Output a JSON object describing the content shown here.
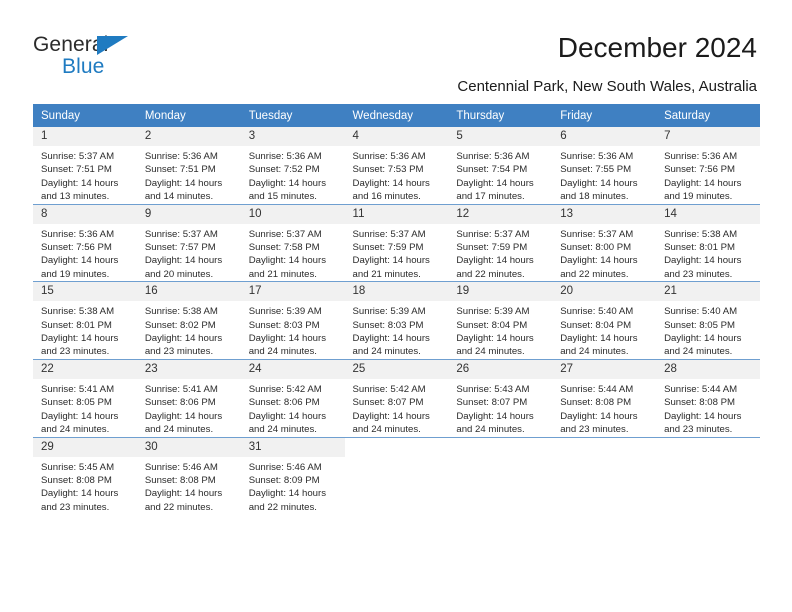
{
  "brand": {
    "name_part1": "General",
    "name_part2": "Blue",
    "accent_color": "#1f7bc1",
    "triangle_icon": "triangle-icon"
  },
  "header": {
    "title": "December 2024",
    "subtitle": "Centennial Park, New South Wales, Australia"
  },
  "calendar": {
    "header_bg": "#3f80c2",
    "daynum_bg": "#f1f1f1",
    "weekdays": [
      "Sunday",
      "Monday",
      "Tuesday",
      "Wednesday",
      "Thursday",
      "Friday",
      "Saturday"
    ],
    "labels": {
      "sunrise": "Sunrise:",
      "sunset": "Sunset:",
      "daylight": "Daylight:"
    },
    "weeks": [
      [
        {
          "day": "1",
          "sunrise": "Sunrise: 5:37 AM",
          "sunset": "Sunset: 7:51 PM",
          "daylight": "Daylight: 14 hours and 13 minutes."
        },
        {
          "day": "2",
          "sunrise": "Sunrise: 5:36 AM",
          "sunset": "Sunset: 7:51 PM",
          "daylight": "Daylight: 14 hours and 14 minutes."
        },
        {
          "day": "3",
          "sunrise": "Sunrise: 5:36 AM",
          "sunset": "Sunset: 7:52 PM",
          "daylight": "Daylight: 14 hours and 15 minutes."
        },
        {
          "day": "4",
          "sunrise": "Sunrise: 5:36 AM",
          "sunset": "Sunset: 7:53 PM",
          "daylight": "Daylight: 14 hours and 16 minutes."
        },
        {
          "day": "5",
          "sunrise": "Sunrise: 5:36 AM",
          "sunset": "Sunset: 7:54 PM",
          "daylight": "Daylight: 14 hours and 17 minutes."
        },
        {
          "day": "6",
          "sunrise": "Sunrise: 5:36 AM",
          "sunset": "Sunset: 7:55 PM",
          "daylight": "Daylight: 14 hours and 18 minutes."
        },
        {
          "day": "7",
          "sunrise": "Sunrise: 5:36 AM",
          "sunset": "Sunset: 7:56 PM",
          "daylight": "Daylight: 14 hours and 19 minutes."
        }
      ],
      [
        {
          "day": "8",
          "sunrise": "Sunrise: 5:36 AM",
          "sunset": "Sunset: 7:56 PM",
          "daylight": "Daylight: 14 hours and 19 minutes."
        },
        {
          "day": "9",
          "sunrise": "Sunrise: 5:37 AM",
          "sunset": "Sunset: 7:57 PM",
          "daylight": "Daylight: 14 hours and 20 minutes."
        },
        {
          "day": "10",
          "sunrise": "Sunrise: 5:37 AM",
          "sunset": "Sunset: 7:58 PM",
          "daylight": "Daylight: 14 hours and 21 minutes."
        },
        {
          "day": "11",
          "sunrise": "Sunrise: 5:37 AM",
          "sunset": "Sunset: 7:59 PM",
          "daylight": "Daylight: 14 hours and 21 minutes."
        },
        {
          "day": "12",
          "sunrise": "Sunrise: 5:37 AM",
          "sunset": "Sunset: 7:59 PM",
          "daylight": "Daylight: 14 hours and 22 minutes."
        },
        {
          "day": "13",
          "sunrise": "Sunrise: 5:37 AM",
          "sunset": "Sunset: 8:00 PM",
          "daylight": "Daylight: 14 hours and 22 minutes."
        },
        {
          "day": "14",
          "sunrise": "Sunrise: 5:38 AM",
          "sunset": "Sunset: 8:01 PM",
          "daylight": "Daylight: 14 hours and 23 minutes."
        }
      ],
      [
        {
          "day": "15",
          "sunrise": "Sunrise: 5:38 AM",
          "sunset": "Sunset: 8:01 PM",
          "daylight": "Daylight: 14 hours and 23 minutes."
        },
        {
          "day": "16",
          "sunrise": "Sunrise: 5:38 AM",
          "sunset": "Sunset: 8:02 PM",
          "daylight": "Daylight: 14 hours and 23 minutes."
        },
        {
          "day": "17",
          "sunrise": "Sunrise: 5:39 AM",
          "sunset": "Sunset: 8:03 PM",
          "daylight": "Daylight: 14 hours and 24 minutes."
        },
        {
          "day": "18",
          "sunrise": "Sunrise: 5:39 AM",
          "sunset": "Sunset: 8:03 PM",
          "daylight": "Daylight: 14 hours and 24 minutes."
        },
        {
          "day": "19",
          "sunrise": "Sunrise: 5:39 AM",
          "sunset": "Sunset: 8:04 PM",
          "daylight": "Daylight: 14 hours and 24 minutes."
        },
        {
          "day": "20",
          "sunrise": "Sunrise: 5:40 AM",
          "sunset": "Sunset: 8:04 PM",
          "daylight": "Daylight: 14 hours and 24 minutes."
        },
        {
          "day": "21",
          "sunrise": "Sunrise: 5:40 AM",
          "sunset": "Sunset: 8:05 PM",
          "daylight": "Daylight: 14 hours and 24 minutes."
        }
      ],
      [
        {
          "day": "22",
          "sunrise": "Sunrise: 5:41 AM",
          "sunset": "Sunset: 8:05 PM",
          "daylight": "Daylight: 14 hours and 24 minutes."
        },
        {
          "day": "23",
          "sunrise": "Sunrise: 5:41 AM",
          "sunset": "Sunset: 8:06 PM",
          "daylight": "Daylight: 14 hours and 24 minutes."
        },
        {
          "day": "24",
          "sunrise": "Sunrise: 5:42 AM",
          "sunset": "Sunset: 8:06 PM",
          "daylight": "Daylight: 14 hours and 24 minutes."
        },
        {
          "day": "25",
          "sunrise": "Sunrise: 5:42 AM",
          "sunset": "Sunset: 8:07 PM",
          "daylight": "Daylight: 14 hours and 24 minutes."
        },
        {
          "day": "26",
          "sunrise": "Sunrise: 5:43 AM",
          "sunset": "Sunset: 8:07 PM",
          "daylight": "Daylight: 14 hours and 24 minutes."
        },
        {
          "day": "27",
          "sunrise": "Sunrise: 5:44 AM",
          "sunset": "Sunset: 8:08 PM",
          "daylight": "Daylight: 14 hours and 23 minutes."
        },
        {
          "day": "28",
          "sunrise": "Sunrise: 5:44 AM",
          "sunset": "Sunset: 8:08 PM",
          "daylight": "Daylight: 14 hours and 23 minutes."
        }
      ],
      [
        {
          "day": "29",
          "sunrise": "Sunrise: 5:45 AM",
          "sunset": "Sunset: 8:08 PM",
          "daylight": "Daylight: 14 hours and 23 minutes."
        },
        {
          "day": "30",
          "sunrise": "Sunrise: 5:46 AM",
          "sunset": "Sunset: 8:08 PM",
          "daylight": "Daylight: 14 hours and 22 minutes."
        },
        {
          "day": "31",
          "sunrise": "Sunrise: 5:46 AM",
          "sunset": "Sunset: 8:09 PM",
          "daylight": "Daylight: 14 hours and 22 minutes."
        },
        {
          "day": "",
          "sunrise": "",
          "sunset": "",
          "daylight": ""
        },
        {
          "day": "",
          "sunrise": "",
          "sunset": "",
          "daylight": ""
        },
        {
          "day": "",
          "sunrise": "",
          "sunset": "",
          "daylight": ""
        },
        {
          "day": "",
          "sunrise": "",
          "sunset": "",
          "daylight": ""
        }
      ]
    ]
  }
}
